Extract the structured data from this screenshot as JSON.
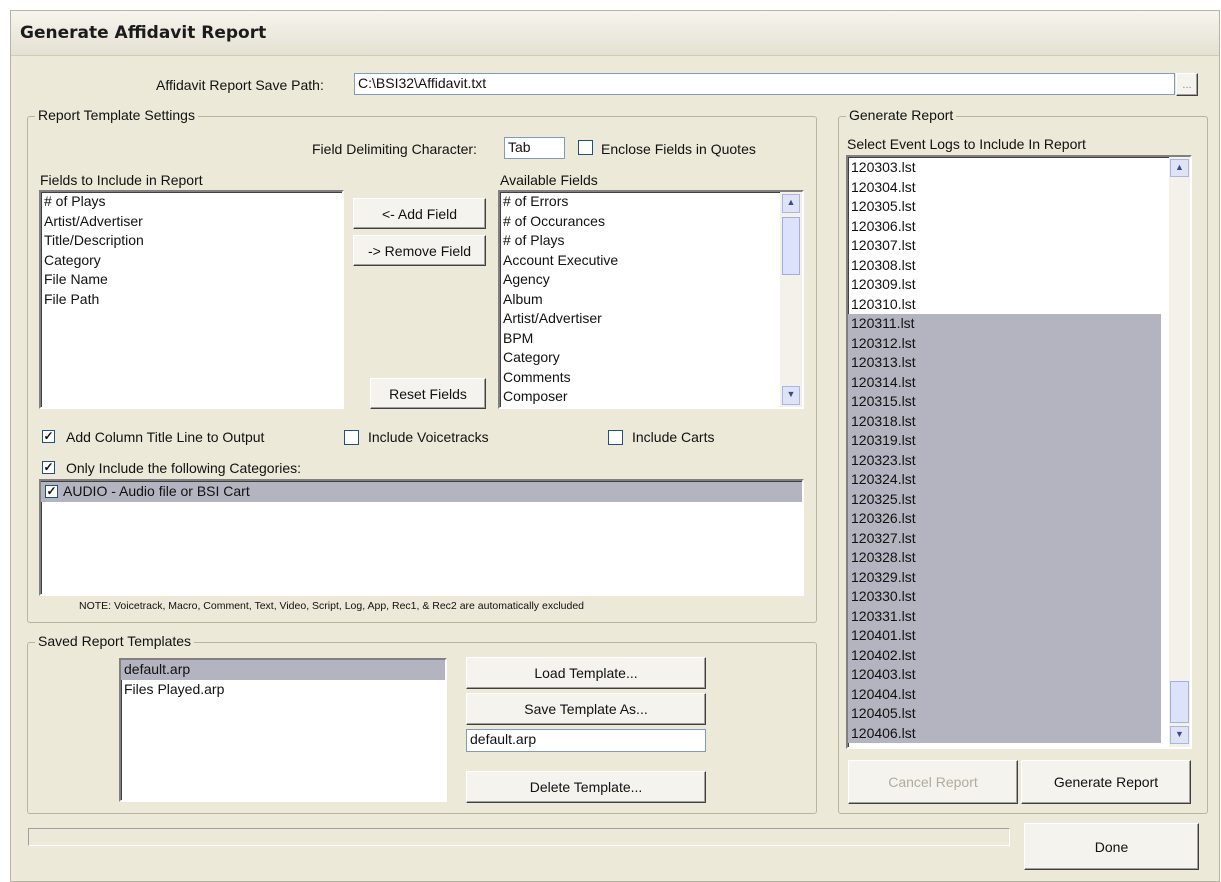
{
  "window": {
    "title": "Generate Affidavit Report"
  },
  "save_path": {
    "label": "Affidavit Report Save Path:",
    "value": "C:\\BSI32\\Affidavit.txt",
    "browse_label": "..."
  },
  "template_settings": {
    "legend": "Report Template Settings",
    "delim_label": "Field Delimiting Character:",
    "delim_value": "Tab",
    "enclose_label": "Enclose Fields in Quotes",
    "fields_label": "Fields to Include in Report",
    "fields": [
      "# of Plays",
      "Artist/Advertiser",
      "Title/Description",
      "Category",
      "File Name",
      "File Path"
    ],
    "available_label": "Available Fields",
    "available": [
      "# of Errors",
      "# of Occurances",
      "# of Plays",
      "Account Executive",
      "Agency",
      "Album",
      "Artist/Advertiser",
      "BPM",
      "Category",
      "Comments",
      "Composer"
    ],
    "add_field": "<- Add Field",
    "remove_field": "-> Remove Field",
    "reset_fields": "Reset Fields",
    "add_column_title": "Add Column Title Line to Output",
    "include_voicetracks": "Include Voicetracks",
    "include_carts": "Include Carts",
    "only_include": "Only Include the following Categories:",
    "categories": [
      "AUDIO  -  Audio file or BSI Cart"
    ],
    "note": "NOTE: Voicetrack, Macro, Comment, Text, Video, Script, Log, App, Rec1, & Rec2 are automatically excluded"
  },
  "saved_templates": {
    "legend": "Saved Report Templates",
    "items": [
      "default.arp",
      "Files Played.arp"
    ],
    "load": "Load Template...",
    "save_as": "Save Template As...",
    "name_value": "default.arp",
    "delete": "Delete Template..."
  },
  "generate": {
    "legend": "Generate Report",
    "select_label": "Select Event Logs to Include In Report",
    "logs": [
      "120303.lst",
      "120304.lst",
      "120305.lst",
      "120306.lst",
      "120307.lst",
      "120308.lst",
      "120309.lst",
      "120310.lst",
      "120311.lst",
      "120312.lst",
      "120313.lst",
      "120314.lst",
      "120315.lst",
      "120318.lst",
      "120319.lst",
      "120323.lst",
      "120324.lst",
      "120325.lst",
      "120326.lst",
      "120327.lst",
      "120328.lst",
      "120329.lst",
      "120330.lst",
      "120331.lst",
      "120401.lst",
      "120402.lst",
      "120403.lst",
      "120404.lst",
      "120405.lst",
      "120406.lst"
    ],
    "selected_from_index": 8,
    "cancel": "Cancel Report",
    "generate": "Generate Report"
  },
  "checkbox_states": {
    "enclose": false,
    "add_column_title": true,
    "include_voicetracks": false,
    "include_carts": false,
    "only_include": true,
    "audio_category": true
  },
  "done": "Done",
  "icons": {
    "scroll_up": "▲",
    "scroll_down": "▼",
    "check": "✓"
  }
}
